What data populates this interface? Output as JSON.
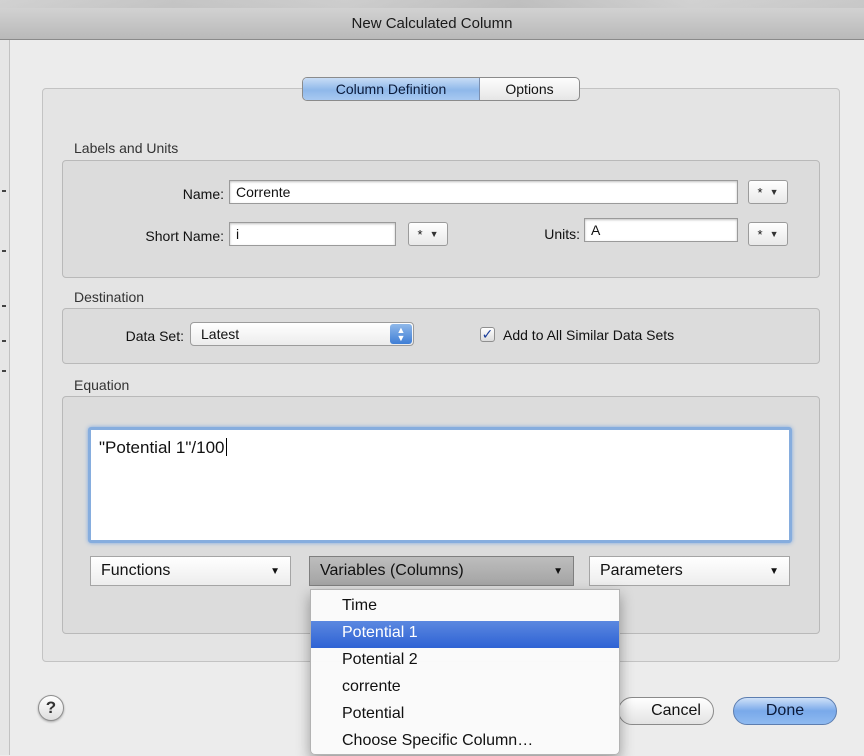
{
  "window": {
    "title": "New Calculated Column"
  },
  "tabs": {
    "column_definition": "Column Definition",
    "options": "Options"
  },
  "labels_units": {
    "section": "Labels and Units",
    "name_label": "Name:",
    "name_value": "Corrente",
    "short_name_label": "Short Name:",
    "short_name_value": "i",
    "units_label": "Units:",
    "units_value": "A",
    "star": "*"
  },
  "destination": {
    "section": "Destination",
    "data_set_label": "Data Set:",
    "data_set_value": "Latest",
    "add_to_all_label": "Add to All Similar Data Sets",
    "add_to_all_checked": true
  },
  "equation": {
    "section": "Equation",
    "value": "\"Potential 1\"/100",
    "functions": "Functions",
    "variables": "Variables (Columns)",
    "parameters": "Parameters"
  },
  "variables_menu": {
    "items": [
      "Time",
      "Potential 1",
      "Potential 2",
      "corrente",
      "Potential",
      "Choose Specific Column…"
    ],
    "selected": "Potential 1"
  },
  "buttons": {
    "help": "?",
    "cancel": "Cancel",
    "done": "Done"
  },
  "colors": {
    "accent": "#3f7ed6",
    "selection": "#2e62d4",
    "focus_ring": "#86adde"
  }
}
